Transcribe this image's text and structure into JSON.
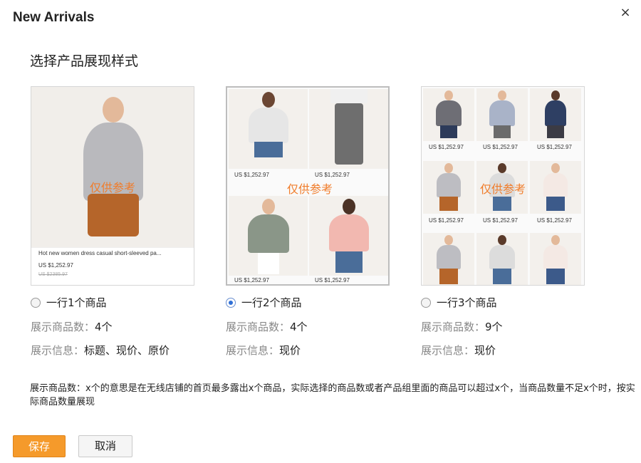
{
  "dialog": {
    "title": "New Arrivals",
    "close_icon": "×"
  },
  "section_title": "选择产品展现样式",
  "watermark": "仅供参考",
  "price": "US $1,252.97",
  "layouts": [
    {
      "radio_label": "一行1个商品",
      "checked": false,
      "count_label": "展示商品数：",
      "count_value": "4个",
      "info_label": "展示信息：",
      "info_value": "标题、现价、原价",
      "caption": {
        "title": "Hot new women dress casual short-sleeved pa...",
        "price": "US $1,252.97",
        "original_price": "US $2385.97"
      }
    },
    {
      "radio_label": "一行2个商品",
      "checked": true,
      "count_label": "展示商品数：",
      "count_value": "4个",
      "info_label": "展示信息：",
      "info_value": "现价"
    },
    {
      "radio_label": "一行3个商品",
      "checked": false,
      "count_label": "展示商品数：",
      "count_value": "9个",
      "info_label": "展示信息：",
      "info_value": "现价"
    }
  ],
  "note": "展示商品数：x个的意思是在无线店铺的首页最多露出x个商品，实际选择的商品数或者产品组里面的商品可以超过x个，当商品数量不足x个时，按实际商品数量展现",
  "buttons": {
    "save": "保存",
    "cancel": "取消"
  },
  "colors": {
    "accent": "#f59a2b",
    "watermark": "#f07c2a",
    "radio_checked": "#2f6fd6"
  }
}
